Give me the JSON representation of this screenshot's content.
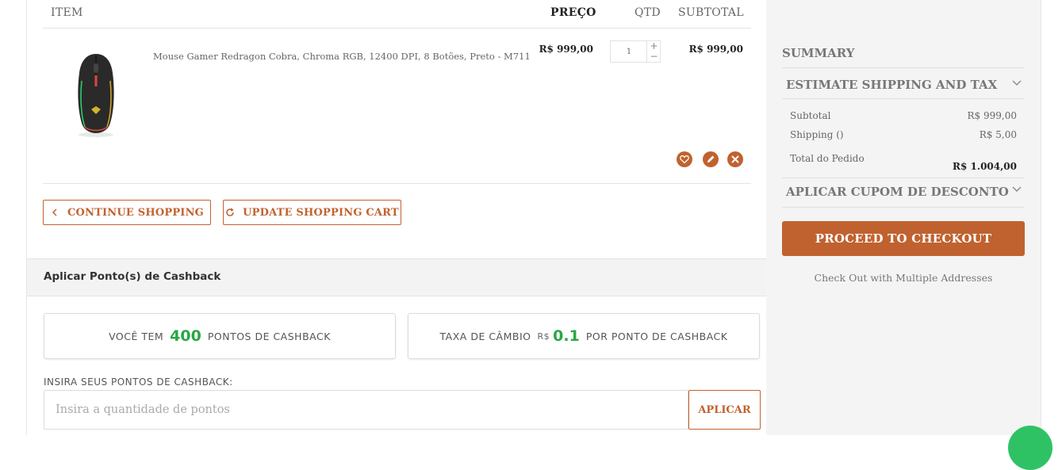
{
  "table": {
    "headers": {
      "item": "ITEM",
      "price": "PREÇO",
      "qty": "QTD",
      "subtotal": "SUBTOTAL"
    },
    "rows": [
      {
        "name": "Mouse Gamer Redragon Cobra, Chroma RGB, 12400 DPI, 8 Botões, Preto - M711",
        "price": "R$ 999,00",
        "qty": "1",
        "subtotal": "R$ 999,00",
        "image_icon": "gaming-mouse-image"
      }
    ],
    "actions": [
      "heart-icon",
      "pencil-icon",
      "close-icon"
    ]
  },
  "buttons": {
    "continue": "CONTINUE SHOPPING",
    "update": "UPDATE SHOPPING CART"
  },
  "cashback": {
    "title": "Aplicar Ponto(s) de Cashback",
    "points_prefix": "VOCÊ TEM",
    "points_value": "400",
    "points_suffix": "PONTOS DE CASHBACK",
    "rate_prefix": "TAXA DE CÂMBIO",
    "rate_currency": "R$",
    "rate_value": "0.1",
    "rate_suffix": "POR PONTO DE CASHBACK",
    "input_label": "INSIRA SEUS PONTOS DE CASHBACK:",
    "input_placeholder": "Insira a quantidade de pontos",
    "apply": "APLICAR"
  },
  "summary": {
    "title": "SUMMARY",
    "shipping_estimate": "ESTIMATE SHIPPING AND TAX",
    "subtotal_label": "Subtotal",
    "subtotal_value": "R$ 999,00",
    "shipping_label": "Shipping ()",
    "shipping_value": "R$ 5,00",
    "total_label": "Total do Pedido",
    "total_value": "R$ 1.004,00",
    "coupon": "APLICAR CUPOM DE DESCONTO",
    "checkout": "PROCEED TO CHECKOUT",
    "multi_address": "Check Out with Multiple Addresses"
  },
  "colors": {
    "accent": "#c0622f",
    "cashback_green": "#28a745",
    "chat_green": "#2fc265",
    "sidebar_bg": "#f4f4f4"
  }
}
